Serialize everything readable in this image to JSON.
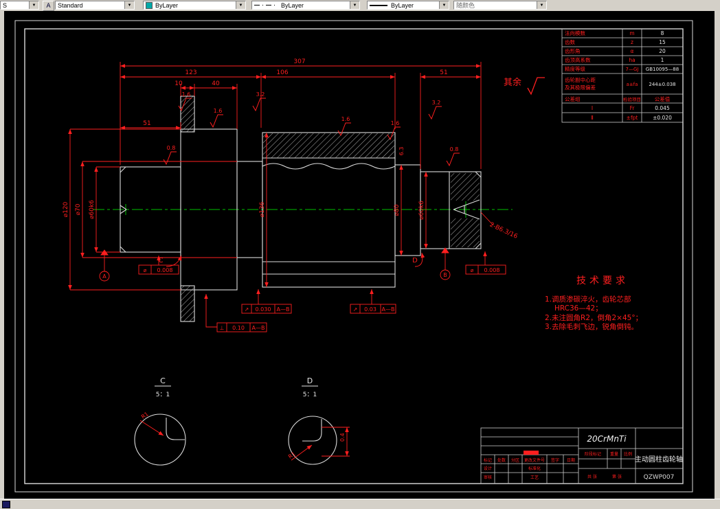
{
  "toolbar": {
    "combo1_value": "S",
    "text_style_value": "Standard",
    "color_value": "ByLayer",
    "linetype_value": "ByLayer",
    "lineweight_value": "ByLayer",
    "plot_style_value": "随颜色"
  },
  "colors": {
    "dim_red": "#ff1f1f",
    "outline_white": "#dcdcdc",
    "centerline_green": "#00c000",
    "chrome_gray": "#d4d0c8",
    "color_swatch": "#00a8a8",
    "canvas_black": "#000000"
  },
  "dims": {
    "len_307": "307",
    "len_123": "123",
    "len_106": "106",
    "len_51_right": "51",
    "len_10": "10",
    "len_40": "40",
    "len_51_left": "51",
    "dia_collar": "⌀120",
    "dia_neck": "⌀70",
    "dia_journal_left": "⌀60k6",
    "dia_gear": "⌀136",
    "dia_step": "⌀80",
    "dia_journal_right": "⌀60k6"
  },
  "roughness": {
    "r1": "1.6",
    "r2": "1.6",
    "r3": "3.2",
    "r4": "1.6",
    "r5": "1.6",
    "r6": "3.2",
    "r7": "0.8",
    "r8": "0.8",
    "r9": "6.3",
    "rest_label": "其余"
  },
  "fcf": {
    "f1_sym": "⌀",
    "f1_val": "0.008",
    "f2_sym": "↗",
    "f2_val": "0.030",
    "f2_datum": "A—B",
    "f3_sym": "↗",
    "f3_val": "0.03",
    "f3_datum": "A—B",
    "f4_sym": "⊥",
    "f4_val": "0.10",
    "f4_datum": "A—B",
    "f5_sym": "⌀",
    "f5_val": "0.008"
  },
  "datums": {
    "a": "A",
    "b": "B"
  },
  "view_markers": {
    "c": "C",
    "d": "D"
  },
  "callouts": {
    "center_hole": "2-B6.3/16"
  },
  "tech_req": {
    "title": "技术要求",
    "line1": "1.调质渗碳淬火，齿轮芯部",
    "line2": "HRC36—42；",
    "line3": "2.未注圆角R2，倒角2×45°；",
    "line4": "3.去除毛刺飞边，锐角倒钝。"
  },
  "gear_table": {
    "r1c1": "法向模数",
    "r1c2": "m",
    "r1c3": "8",
    "r2c1": "齿数",
    "r2c2": "z",
    "r2c3": "15",
    "r3c1": "齿形角",
    "r3c2": "α",
    "r3c3": "20",
    "r4c1": "齿顶高系数",
    "r4c2": "ha",
    "r4c3": "1",
    "r5c1": "精度等级",
    "r5c2": "7—GJ",
    "r5c3": "GB10095—88",
    "r6c1a": "齿轮副中心距",
    "r6c1b": "及其极限偏差",
    "r6c2": "a±fa",
    "r6c3": "244±0.038",
    "r7c1": "公差组",
    "r7c2": "检验项目",
    "r7c3": "公差值",
    "r8c1": "Ⅰ",
    "r8c2": "Fr",
    "r8c3": "0.045",
    "r9c1": "Ⅱ",
    "r9c2": "±fpt",
    "r9c3": "±0.020"
  },
  "details": {
    "c_label": "C",
    "c_scale": "5：1",
    "c_r": "R1",
    "d_label": "D",
    "d_scale": "5：1",
    "d_r": "R1",
    "d_dim": "0.4"
  },
  "title_block": {
    "material": "20CrMnTi",
    "part_name": "主动圆柱齿轮轴",
    "drawing_no": "QZWP007",
    "stage": "阶段标记",
    "weight": "重量",
    "scale": "比例",
    "sheets": "共 张",
    "sheet_no": "第 张",
    "mark": "标记",
    "count": "处数",
    "zone": "分区",
    "doc": "更改文件号",
    "sign": "签字",
    "date": "日期",
    "design": "设计",
    "check": "审核",
    "standard": "标准化",
    "process": "工艺"
  }
}
